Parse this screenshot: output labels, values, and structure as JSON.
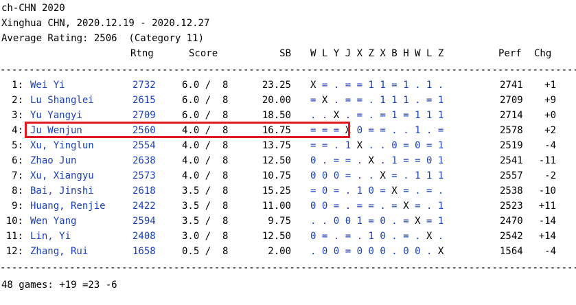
{
  "header": {
    "title": "ch-CHN 2020",
    "location_dates": "Xinghua CHN, 2020.12.19 - 2020.12.27",
    "average_rating": "Average Rating: 2506  (Category 11)"
  },
  "columns": {
    "rating": "Rtng",
    "score": "Score",
    "sb": "SB",
    "opponents": [
      "W",
      "L",
      "Y",
      "J",
      "X",
      "Z",
      "X",
      "B",
      "H",
      "W",
      "L",
      "Z"
    ],
    "perf": "Perf",
    "chg": "Chg"
  },
  "separator": "------------------------------------------------------------------------------------------------------------",
  "rows": [
    {
      "rank": "1:",
      "name": "Wei Yi",
      "rating": "2732",
      "score": "6.0 /  8",
      "sb": "23.25",
      "results": [
        "X",
        "=",
        ".",
        "=",
        "=",
        "1",
        "1",
        "=",
        "1",
        ".",
        "1",
        "."
      ],
      "perf": "2741",
      "chg": "+1"
    },
    {
      "rank": "2:",
      "name": "Lu Shanglei",
      "rating": "2615",
      "score": "6.0 /  8",
      "sb": "20.00",
      "results": [
        "=",
        "X",
        ".",
        "=",
        "=",
        ".",
        "1",
        "1",
        "1",
        ".",
        "=",
        "1"
      ],
      "perf": "2709",
      "chg": "+9"
    },
    {
      "rank": "3:",
      "name": "Yu Yangyi",
      "rating": "2709",
      "score": "6.0 /  8",
      "sb": "18.50",
      "results": [
        ".",
        ".",
        "X",
        ".",
        "=",
        ".",
        "=",
        "1",
        "=",
        "1",
        "1",
        "1"
      ],
      "perf": "2714",
      "chg": "+0"
    },
    {
      "rank": "4:",
      "name": "Ju Wenjun",
      "rating": "2560",
      "score": "4.0 /  8",
      "sb": "16.75",
      "results": [
        "=",
        "=",
        "=",
        "X",
        "0",
        "=",
        "=",
        ".",
        ".",
        "1",
        ".",
        "="
      ],
      "perf": "2578",
      "chg": "+2"
    },
    {
      "rank": "5:",
      "name": "Xu, Yinglun",
      "rating": "2554",
      "score": "4.0 /  8",
      "sb": "13.75",
      "results": [
        "=",
        "=",
        ".",
        "1",
        "X",
        ".",
        ".",
        "0",
        "=",
        "0",
        "=",
        "1"
      ],
      "perf": "2519",
      "chg": "-4"
    },
    {
      "rank": "6:",
      "name": "Zhao Jun",
      "rating": "2638",
      "score": "4.0 /  8",
      "sb": "12.50",
      "results": [
        "0",
        ".",
        "=",
        "=",
        ".",
        "X",
        ".",
        "1",
        "=",
        "=",
        "0",
        "1"
      ],
      "perf": "2541",
      "chg": "-11"
    },
    {
      "rank": "7:",
      "name": "Xu, Xiangyu",
      "rating": "2573",
      "score": "4.0 /  8",
      "sb": "10.75",
      "results": [
        "0",
        "0",
        "0",
        "=",
        ".",
        ".",
        "X",
        "=",
        ".",
        "1",
        "1",
        "1"
      ],
      "perf": "2557",
      "chg": "-2"
    },
    {
      "rank": "8:",
      "name": "Bai, Jinshi",
      "rating": "2618",
      "score": "3.5 /  8",
      "sb": "15.25",
      "results": [
        "=",
        "0",
        "=",
        ".",
        "1",
        "0",
        "=",
        "X",
        "=",
        ".",
        "=",
        "."
      ],
      "perf": "2538",
      "chg": "-10"
    },
    {
      "rank": "9:",
      "name": "Huang, Renjie",
      "rating": "2422",
      "score": "3.5 /  8",
      "sb": "11.00",
      "results": [
        "0",
        "0",
        "=",
        ".",
        "=",
        "=",
        ".",
        "=",
        "X",
        "=",
        ".",
        "1"
      ],
      "perf": "2523",
      "chg": "+11"
    },
    {
      "rank": "10:",
      "name": "Wen Yang",
      "rating": "2594",
      "score": "3.5 /  8",
      "sb": "9.75",
      "results": [
        ".",
        ".",
        "0",
        "0",
        "1",
        "=",
        "0",
        ".",
        "=",
        "X",
        "=",
        "1"
      ],
      "perf": "2470",
      "chg": "-14"
    },
    {
      "rank": "11:",
      "name": "Lin, Yi",
      "rating": "2408",
      "score": "3.0 /  8",
      "sb": "12.50",
      "results": [
        "0",
        "=",
        ".",
        "=",
        ".",
        "1",
        "0",
        ".",
        "=",
        ".",
        "X",
        "."
      ],
      "perf": "2542",
      "chg": "+14"
    },
    {
      "rank": "12:",
      "name": "Zhang, Rui",
      "rating": "1658",
      "score": "0.5 /  8",
      "sb": "2.00",
      "results": [
        ".",
        "0",
        "0",
        "=",
        "0",
        "0",
        "0",
        ".",
        "0",
        "0",
        ".",
        "X"
      ],
      "perf": "1564",
      "chg": "-4"
    }
  ],
  "footer": "48 games: +19 =23 -6",
  "colors": {
    "link_blue": "#1a3fbf",
    "highlight_red": "#e4171e",
    "text": "#000000",
    "background": "#ffffff"
  }
}
